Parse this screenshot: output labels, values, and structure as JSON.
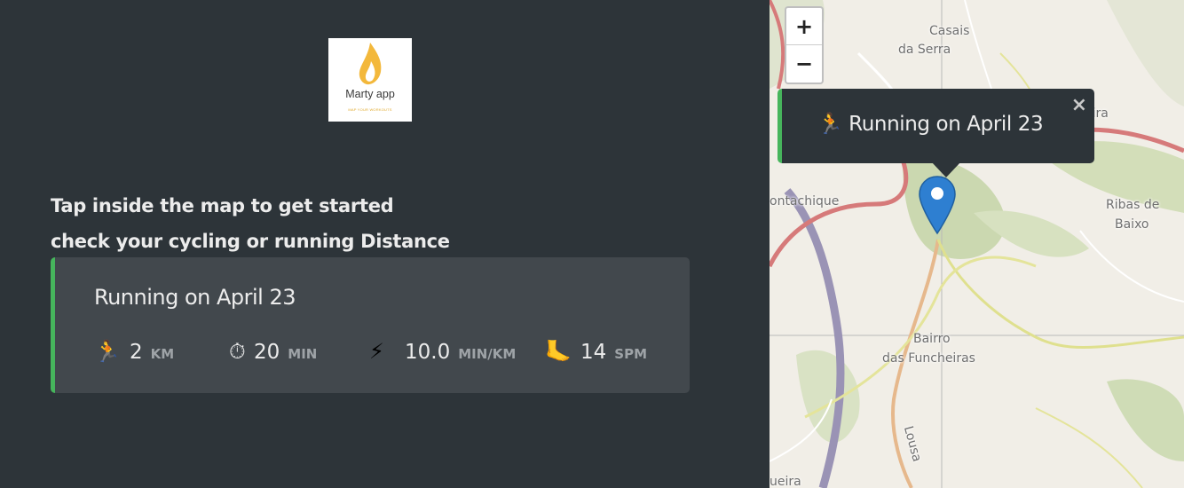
{
  "logo": {
    "name": "Marty app",
    "tagline": "MAP YOUR WORKOUTS"
  },
  "instructions": {
    "line1": "Tap inside the map to get started",
    "line2": "check your cycling or running Distance"
  },
  "workout": {
    "title": "Running on April 23",
    "type_icon": "running-person-icon",
    "distance": {
      "icon": "🏃",
      "value": "2",
      "unit": "KM"
    },
    "duration": {
      "icon": "⏱",
      "value": "20",
      "unit": "MIN"
    },
    "pace": {
      "icon": "⚡",
      "value": "10.0",
      "unit": "MIN/KM"
    },
    "cadence": {
      "icon": "🦶",
      "value": "14",
      "unit": "SPM"
    },
    "accent_color": "#46b55c"
  },
  "map": {
    "zoom_in": "+",
    "zoom_out": "−",
    "popup": {
      "icon": "🏃",
      "text": "Running on April 23",
      "close": "×"
    },
    "labels": {
      "casais": "Casais",
      "da_serra": "da Serra",
      "eira": "eira",
      "ontachique": "ontachique",
      "ribas_de": "Ribas de",
      "baixo": "Baixo",
      "bairro": "Bairro",
      "das_funcheiras": "das Funcheiras",
      "lousa": "Lousa",
      "ueira": "ueira"
    },
    "marker_color": "#2e7fd1"
  }
}
